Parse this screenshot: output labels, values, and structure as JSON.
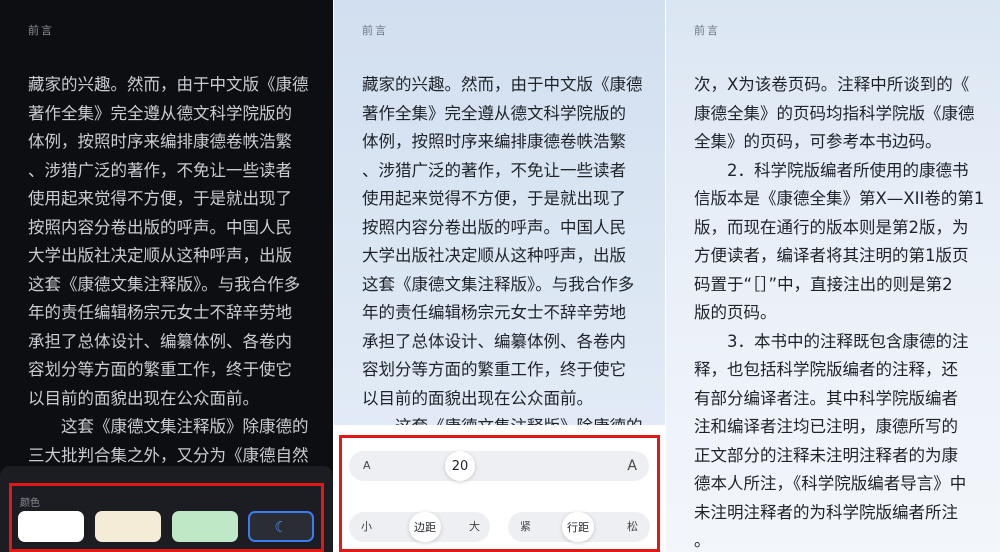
{
  "header": "前言",
  "panel_dark": {
    "lines": [
      "藏家的兴趣。然而，由于中文版《康德",
      "著作全集》完全遵从德文科学院版的",
      "体例，按照时序来编排康德卷帙浩繁",
      "、涉猎广泛的著作，不免让一些读者",
      "使用起来觉得不方便，于是就出现了",
      "按照内容分卷出版的呼声。中国人民",
      "大学出版社决定顺从这种呼声，出版",
      "这套《康德文集注释版》。与我合作多",
      "年的责任编辑杨宗元女士不辞辛劳地",
      "承担了总体设计、编纂体例、各卷内",
      "容划分等方面的繁重工作，终于使它",
      "以目前的面貌出现在公众面前。",
      "这套《康德文集注释版》除康德的",
      "三大批判合集之外，又分为《康德自然"
    ],
    "color_label": "颜色",
    "swatches": [
      "white",
      "cream",
      "green",
      "night"
    ],
    "night_icon": "☾"
  },
  "panel_light": {
    "lines": [
      "藏家的兴趣。然而，由于中文版《康德",
      "著作全集》完全遵从德文科学院版的",
      "体例，按照时序来编排康德卷帙浩繁",
      "、涉猎广泛的著作，不免让一些读者",
      "使用起来觉得不方便，于是就出现了",
      "按照内容分卷出版的呼声。中国人民",
      "大学出版社决定顺从这种呼声，出版",
      "这套《康德文集注释版》。与我合作多",
      "年的责任编辑杨宗元女士不辞辛劳地",
      "承担了总体设计、编纂体例、各卷内",
      "容划分等方面的繁重工作，终于使它",
      "以目前的面貌出现在公众面前。"
    ],
    "cut_line": "这套《康德文集注释版》除康德的",
    "font_size": {
      "small_label": "A",
      "value": "20",
      "large_label": "A"
    },
    "margin": {
      "left_label": "小",
      "knob_label": "边距",
      "right_label": "大"
    },
    "line_spacing": {
      "left_label": "紧",
      "knob_label": "行距",
      "right_label": "松"
    }
  },
  "panel_right": {
    "lines": [
      "次，X为该卷页码。注释中所谈到的《",
      "康德全集》的页码均指科学院版《康德",
      "全集》的页码，可参考本书边码。",
      "2．科学院版编者所使用的康德书",
      "信版本是《康德全集》第X—XII卷的第1",
      "版，而现在通行的版本则是第2版，为",
      "方便读者，编译者将其注明的第1版页",
      "码置于“［］”中，直接注出的则是第2",
      "版的页码。",
      "3．本书中的注释既包含康德的注",
      "释，也包括科学院版编者的注释，还",
      "有部分编译者注。其中科学院版编者",
      "注和编译者注均已注明，康德所写的",
      "正文部分的注释未注明注释者的为康",
      "德本人所注，《科学院版编者导言》中",
      "未注明注释者的为科学院版编者所注",
      "。"
    ],
    "indent_lines": [
      3,
      9
    ]
  },
  "colors": {
    "highlight": "#e01818",
    "accent": "#3d7bf0"
  }
}
